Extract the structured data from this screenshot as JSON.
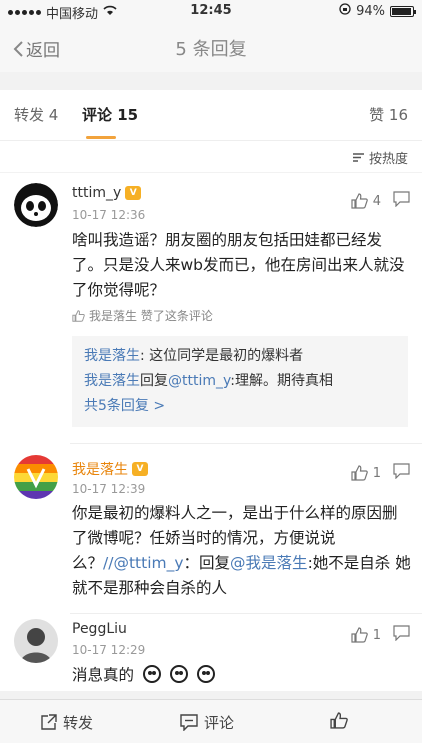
{
  "status_bar": {
    "carrier": "中国移动",
    "time": "12:45",
    "battery": "94%",
    "battery_level": 0.94
  },
  "nav": {
    "back_label": "返回",
    "title": "5 条回复"
  },
  "tabs": {
    "repost": "转发 4",
    "comment": "评论 15",
    "like": "赞 16"
  },
  "sort": {
    "label": "按热度"
  },
  "comments": [
    {
      "username": "tttim_y",
      "time": "10-17 12:36",
      "likes": "4",
      "text": "啥叫我造谣？朋友圈的朋友包括田娃都已经发了。只是没人来wb发而已，他在房间出来人就没了你觉得呢？",
      "liked_by": "我是落生 赞了这条评论",
      "replies": [
        {
          "name": "我是落生",
          "text": ": 这位同学是最初的爆料者"
        },
        {
          "name": "我是落生",
          "text": "回复",
          "mention": "@tttim_y",
          "tail": ":理解。期待真相"
        }
      ],
      "more_replies": "共5条回复 >"
    },
    {
      "username": "我是落生",
      "time": "10-17 12:39",
      "likes": "1",
      "text_a": "你是最初的爆料人之一，是出于什么样的原因删了微博呢？任娇当时的情况，方便说说么？",
      "mention_a": "//@tttim_y",
      "text_b": "：回复",
      "mention_b": "@我是落生",
      "text_c": ":她不是自杀 她就不是那种会自杀的人"
    },
    {
      "username": "PeggLiu",
      "time": "10-17 12:29",
      "likes": "1",
      "text": "消息真的"
    }
  ],
  "bottom_bar": {
    "repost": "转发",
    "comment": "评论"
  }
}
